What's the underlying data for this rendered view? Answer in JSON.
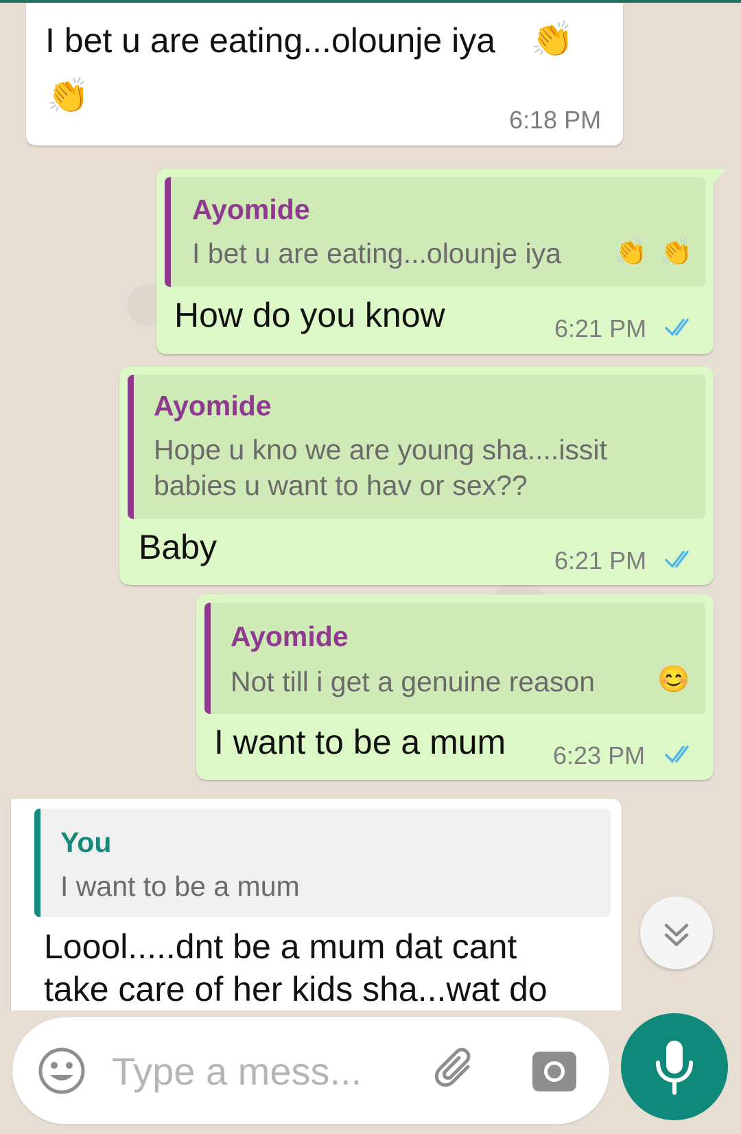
{
  "theme": {
    "outgoing_bubble": "#dcf8c6",
    "incoming_bubble": "#ffffff",
    "quote_name_other": "#8e3a8e",
    "quote_name_you": "#17897b",
    "read_ticks": "#4fb6ec",
    "mic_button": "#0f8a7a"
  },
  "messages": [
    {
      "direction": "incoming",
      "text": "I bet u are eating...olounje iya",
      "emoji": "clapping-hands",
      "time": "6:18 PM"
    },
    {
      "direction": "outgoing",
      "quote": {
        "author": "Ayomide",
        "text": "I bet u are eating...olounje iya"
      },
      "text": "How do you know",
      "time": "6:21 PM",
      "status": "read-double-tick"
    },
    {
      "direction": "outgoing",
      "quote": {
        "author": "Ayomide",
        "line1": "Hope u kno we are young sha....issit",
        "line2": "babies u want to hav or sex??"
      },
      "text": "Baby",
      "time": "6:21 PM",
      "status": "read-double-tick"
    },
    {
      "direction": "outgoing",
      "quote": {
        "author": "Ayomide",
        "text": "Not till i get a genuine reason",
        "emoji": "smiling-face"
      },
      "text": "I want to be a mum",
      "time": "6:23 PM",
      "status": "read-double-tick"
    },
    {
      "direction": "incoming",
      "quote": {
        "author": "You",
        "text": "I want to be a mum"
      },
      "line1": "Loool.....dnt be a mum dat cant",
      "line2": "take care of her kids sha...wat do"
    }
  ],
  "composer": {
    "placeholder": "Type a mess...",
    "icons": [
      "emoji-icon",
      "attach-icon",
      "camera-icon",
      "mic-icon"
    ]
  },
  "scroll_button_icon": "double-chevron-down-icon"
}
